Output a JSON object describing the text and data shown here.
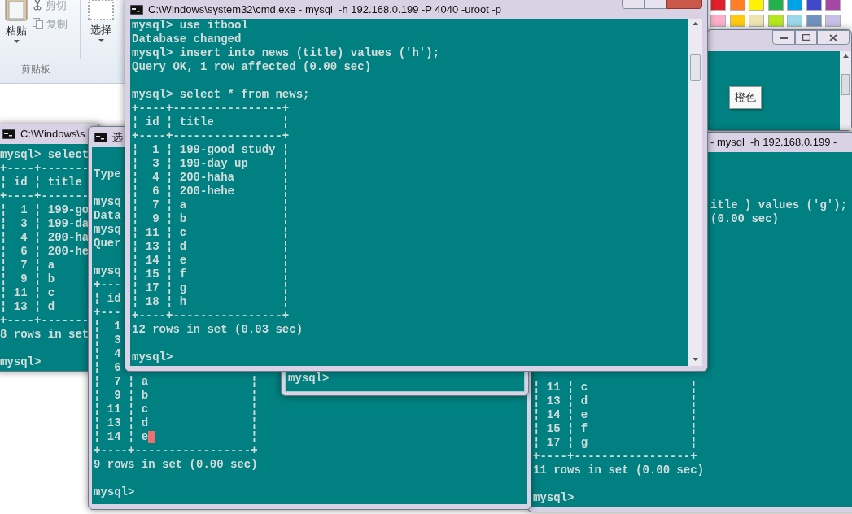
{
  "ribbon": {
    "paste": {
      "label": "粘贴"
    },
    "cut": {
      "label": "剪切",
      "disabled": true
    },
    "copy": {
      "label": "复制",
      "disabled": true
    },
    "select": {
      "label": "选择"
    },
    "group_label": "剪贴板"
  },
  "palette": [
    {
      "color": "#e0202a"
    },
    {
      "color": "#ff7f27"
    },
    {
      "color": "#fff200"
    },
    {
      "color": "#22b14c"
    },
    {
      "color": "#00a2e8"
    },
    {
      "color": "#3f48cc"
    },
    {
      "color": "#a349a4"
    },
    {
      "color": "#ffaec9"
    },
    {
      "color": "#ffc90e"
    },
    {
      "color": "#efe4b0"
    },
    {
      "color": "#b5e61d"
    },
    {
      "color": "#99d9ea"
    },
    {
      "color": "#7092be"
    },
    {
      "color": "#c8bfe7"
    }
  ],
  "left_console": {
    "title": "C:\\Windows\\s",
    "blocks": [
      [
        "mysql> select",
        "+----+-------",
        "¦ id ¦ title",
        "+----+-------",
        "¦  1 ¦ 199-go",
        "¦  3 ¦ 199-da",
        "¦  4 ¦ 200-ha",
        "¦  6 ¦ 200-he",
        "¦  7 ¦ a",
        "¦  9 ¦ b",
        "¦ 11 ¦ c",
        "¦ 13 ¦ d",
        "+----+-------",
        "8 rows in set"
      ],
      [
        "mysql>"
      ]
    ]
  },
  "right_console": {
    "title": "- mysql  -h 192.168.0.199 -",
    "fragment_lines": [
      "itle ) values ('g');",
      "(0.00 sec)"
    ],
    "blocks": [
      [
        "¦ 11 ¦ c               ¦",
        "¦ 13 ¦ d               ¦",
        "¦ 14 ¦ e               ¦",
        "¦ 15 ¦ f               ¦",
        "¦ 17 ¦ g               ¦",
        "+----+-----------------+",
        "11 rows in set (0.00 sec)"
      ],
      [
        "mysql>"
      ]
    ]
  },
  "middle_console": {
    "title": "选",
    "blocks": [
      [
        "Type"
      ],
      [
        "mysq",
        "Data",
        "mysq",
        "Quer"
      ],
      [
        "mysq",
        "+---",
        "¦ id",
        "+---",
        "¦  1",
        "¦  3",
        "¦  4",
        "¦  6",
        "¦  7 ¦ a               ¦",
        "¦  9 ¦ b               ¦",
        "¦ 11 ¦ c               ¦",
        "¦ 13 ¦ d               ¦",
        {
          "text": "¦ 14 ¦ e",
          "cursor": true,
          "after": "              ¦"
        },
        "+----+-----------------+",
        "9 rows in set (0.00 sec)"
      ],
      [
        "mysql>"
      ]
    ]
  },
  "small_console": {
    "blocks": [
      [
        "mysql>"
      ]
    ]
  },
  "main_console": {
    "title": "C:\\Windows\\system32\\cmd.exe - mysql  -h 192.168.0.199 -P 4040 -uroot -p",
    "blocks": [
      [
        "mysql> use itbool",
        "Database changed",
        "mysql> insert into news (title) values ('h');",
        "Query OK, 1 row affected (0.00 sec)"
      ],
      [
        "mysql> select * from news;",
        "+----+----------------+",
        "¦ id ¦ title          ¦",
        "+----+----------------+",
        "¦  1 ¦ 199-good study ¦",
        "¦  3 ¦ 199-day up     ¦",
        "¦  4 ¦ 200-haha       ¦",
        "¦  6 ¦ 200-hehe       ¦",
        "¦  7 ¦ a              ¦",
        "¦  9 ¦ b              ¦",
        "¦ 11 ¦ c              ¦",
        "¦ 13 ¦ d              ¦",
        "¦ 14 ¦ e              ¦",
        "¦ 15 ¦ f              ¦",
        "¦ 17 ¦ g              ¦",
        "¦ 18 ¦ h              ¦",
        "+----+----------------+",
        "12 rows in set (0.03 sec)"
      ],
      [
        "mysql>"
      ]
    ]
  },
  "tooltip": "橙色"
}
